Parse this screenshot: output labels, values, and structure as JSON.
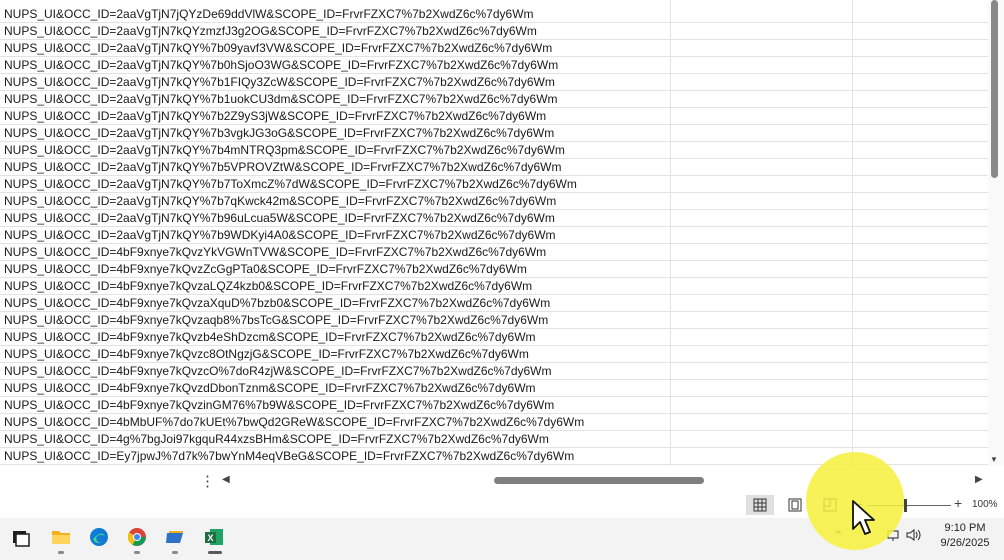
{
  "sheet": {
    "rows": [
      "NUPS_UI&OCC_ID=2aaVgTjN7jQYzDe69ddVlW&SCOPE_ID=FrvrFZXC7%7b2XwdZ6c%7dy6Wm",
      "NUPS_UI&OCC_ID=2aaVgTjN7kQYzmzfJ3g2OG&SCOPE_ID=FrvrFZXC7%7b2XwdZ6c%7dy6Wm",
      "NUPS_UI&OCC_ID=2aaVgTjN7kQY%7b09yavf3VW&SCOPE_ID=FrvrFZXC7%7b2XwdZ6c%7dy6Wm",
      "NUPS_UI&OCC_ID=2aaVgTjN7kQY%7b0hSjoO3WG&SCOPE_ID=FrvrFZXC7%7b2XwdZ6c%7dy6Wm",
      "NUPS_UI&OCC_ID=2aaVgTjN7kQY%7b1FIQy3ZcW&SCOPE_ID=FrvrFZXC7%7b2XwdZ6c%7dy6Wm",
      "NUPS_UI&OCC_ID=2aaVgTjN7kQY%7b1uokCU3dm&SCOPE_ID=FrvrFZXC7%7b2XwdZ6c%7dy6Wm",
      "NUPS_UI&OCC_ID=2aaVgTjN7kQY%7b2Z9yS3jW&SCOPE_ID=FrvrFZXC7%7b2XwdZ6c%7dy6Wm",
      "NUPS_UI&OCC_ID=2aaVgTjN7kQY%7b3vgkJG3oG&SCOPE_ID=FrvrFZXC7%7b2XwdZ6c%7dy6Wm",
      "NUPS_UI&OCC_ID=2aaVgTjN7kQY%7b4mNTRQ3pm&SCOPE_ID=FrvrFZXC7%7b2XwdZ6c%7dy6Wm",
      "NUPS_UI&OCC_ID=2aaVgTjN7kQY%7b5VPROVZtW&SCOPE_ID=FrvrFZXC7%7b2XwdZ6c%7dy6Wm",
      "NUPS_UI&OCC_ID=2aaVgTjN7kQY%7b7ToXmcZ%7dW&SCOPE_ID=FrvrFZXC7%7b2XwdZ6c%7dy6Wm",
      "NUPS_UI&OCC_ID=2aaVgTjN7kQY%7b7qKwck42m&SCOPE_ID=FrvrFZXC7%7b2XwdZ6c%7dy6Wm",
      "NUPS_UI&OCC_ID=2aaVgTjN7kQY%7b96uLcua5W&SCOPE_ID=FrvrFZXC7%7b2XwdZ6c%7dy6Wm",
      "NUPS_UI&OCC_ID=2aaVgTjN7kQY%7b9WDKyi4A0&SCOPE_ID=FrvrFZXC7%7b2XwdZ6c%7dy6Wm",
      "NUPS_UI&OCC_ID=4bF9xnye7kQvzYkVGWnTVW&SCOPE_ID=FrvrFZXC7%7b2XwdZ6c%7dy6Wm",
      "NUPS_UI&OCC_ID=4bF9xnye7kQvzZcGgPTa0&SCOPE_ID=FrvrFZXC7%7b2XwdZ6c%7dy6Wm",
      "NUPS_UI&OCC_ID=4bF9xnye7kQvzaLQZ4kzb0&SCOPE_ID=FrvrFZXC7%7b2XwdZ6c%7dy6Wm",
      "NUPS_UI&OCC_ID=4bF9xnye7kQvzaXquD%7bzb0&SCOPE_ID=FrvrFZXC7%7b2XwdZ6c%7dy6Wm",
      "NUPS_UI&OCC_ID=4bF9xnye7kQvzaqb8%7bsTcG&SCOPE_ID=FrvrFZXC7%7b2XwdZ6c%7dy6Wm",
      "NUPS_UI&OCC_ID=4bF9xnye7kQvzb4eShDzcm&SCOPE_ID=FrvrFZXC7%7b2XwdZ6c%7dy6Wm",
      "NUPS_UI&OCC_ID=4bF9xnye7kQvzc8OtNgzjG&SCOPE_ID=FrvrFZXC7%7b2XwdZ6c%7dy6Wm",
      "NUPS_UI&OCC_ID=4bF9xnye7kQvzcO%7doR4zjW&SCOPE_ID=FrvrFZXC7%7b2XwdZ6c%7dy6Wm",
      "NUPS_UI&OCC_ID=4bF9xnye7kQvzdDbonTznm&SCOPE_ID=FrvrFZXC7%7b2XwdZ6c%7dy6Wm",
      "NUPS_UI&OCC_ID=4bF9xnye7kQvzinGM76%7b9W&SCOPE_ID=FrvrFZXC7%7b2XwdZ6c%7dy6Wm",
      "NUPS_UI&OCC_ID=4bMbUF%7do7kUEt%7bwQd2GReW&SCOPE_ID=FrvrFZXC7%7b2XwdZ6c%7dy6Wm",
      "NUPS_UI&OCC_ID=4g%7bgJoi97kgquR44xzsBHm&SCOPE_ID=FrvrFZXC7%7b2XwdZ6c%7dy6Wm",
      "NUPS_UI&OCC_ID=Ey7jpwJ%7d7k%7bwYnM4eqVBeG&SCOPE_ID=FrvrFZXC7%7b2XwdZ6c%7dy6Wm"
    ]
  },
  "statusbar": {
    "zoom_minus": "−",
    "zoom_plus": "+",
    "zoom_level": "100%",
    "zoom_fraction": 0.45,
    "views": [
      "normal-view",
      "page-layout-view",
      "page-break-preview"
    ]
  },
  "scroll": {
    "h_more": "⋮",
    "left_arrow": "◀",
    "right_arrow": "▶",
    "down_arrow": "▼"
  },
  "taskbar": {
    "apps": [
      "task-view",
      "file-explorer",
      "edge",
      "chrome",
      "folder-app",
      "excel"
    ],
    "tray_chevron": "⌃",
    "time": "9:10 PM",
    "date": "9/26/2025"
  },
  "colors": {
    "excel_green": "#1d6f42",
    "highlight_yellow": "#f7f03c",
    "edge_blue": "#0f7bd4"
  }
}
